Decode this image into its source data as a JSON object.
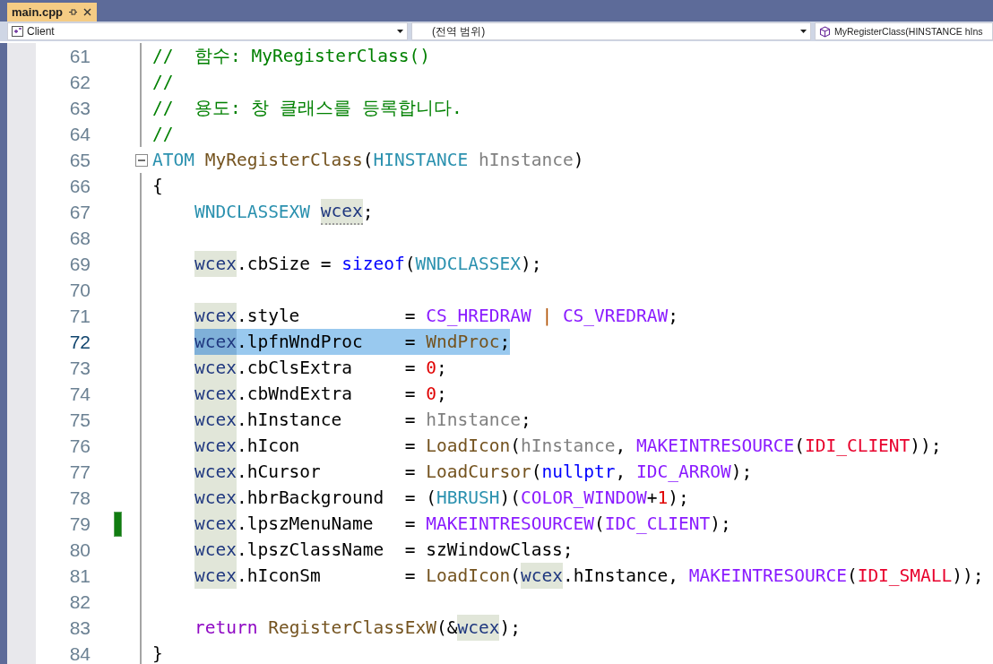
{
  "tabs": [
    {
      "label": "main.cpp",
      "selected": true
    }
  ],
  "navigation": {
    "project": "Client",
    "scope": "(전역 범위)",
    "member": "MyRegisterClass(HINSTANCE hIns"
  },
  "lines": [
    {
      "number": "61",
      "selected": false,
      "changed": false,
      "indented": false,
      "tokens": [
        {
          "kind": "comment",
          "text": "//  함수: MyRegisterClass()"
        }
      ]
    },
    {
      "number": "62",
      "selected": false,
      "changed": false,
      "indented": false,
      "tokens": [
        {
          "kind": "comment",
          "text": "//"
        }
      ]
    },
    {
      "number": "63",
      "selected": false,
      "changed": false,
      "indented": false,
      "tokens": [
        {
          "kind": "comment",
          "text": "//  용도: 창 클래스를 등록합니다."
        }
      ]
    },
    {
      "number": "64",
      "selected": false,
      "changed": false,
      "indented": false,
      "tokens": [
        {
          "kind": "comment",
          "text": "//"
        }
      ]
    },
    {
      "number": "65",
      "selected": false,
      "changed": false,
      "indented": false,
      "expanded": true,
      "tokens": [
        {
          "kind": "type",
          "text": "ATOM"
        },
        {
          "kind": "function",
          "text": " MyRegisterClass"
        },
        {
          "kind": "plain",
          "text": "("
        },
        {
          "kind": "type",
          "text": "HINSTANCE"
        },
        {
          "kind": "param",
          "text": " hInstance"
        },
        {
          "kind": "plain",
          "text": ")"
        }
      ]
    },
    {
      "number": "66",
      "selected": false,
      "changed": false,
      "indented": false,
      "tokens": [
        {
          "kind": "plain",
          "text": "{"
        }
      ]
    },
    {
      "number": "67",
      "selected": false,
      "changed": false,
      "indented": true,
      "tokens": [
        {
          "kind": "type",
          "text": "WNDCLASSEXW "
        },
        {
          "kind": "local",
          "text": "wcex",
          "hint": true
        },
        {
          "kind": "plain",
          "text": ";"
        }
      ]
    },
    {
      "number": "68",
      "selected": false,
      "changed": false
    },
    {
      "number": "69",
      "selected": false,
      "changed": false,
      "indented": true,
      "tokens": [
        {
          "kind": "local",
          "text": "wcex"
        },
        {
          "kind": "plain",
          "text": ".cbSize = "
        },
        {
          "kind": "keyword",
          "text": "sizeof"
        },
        {
          "kind": "plain",
          "text": "("
        },
        {
          "kind": "type",
          "text": "WNDCLASSEX"
        },
        {
          "kind": "plain",
          "text": ");"
        }
      ]
    },
    {
      "number": "70",
      "selected": false,
      "changed": false
    },
    {
      "number": "71",
      "selected": false,
      "changed": false,
      "indented": true,
      "tokens": [
        {
          "kind": "local",
          "text": "wcex"
        },
        {
          "kind": "plain",
          "text": ".style          = "
        },
        {
          "kind": "macro",
          "text": "CS_HREDRAW"
        },
        {
          "kind": "operator",
          "text": " |"
        },
        {
          "kind": "macro",
          "text": " CS_VREDRAW"
        },
        {
          "kind": "plain",
          "text": ";"
        }
      ]
    },
    {
      "number": "72",
      "selected": true,
      "changed": false,
      "indented": true,
      "tokens": [
        {
          "kind": "local",
          "text": "wcex"
        },
        {
          "kind": "plain",
          "text": ".lpfnWndProc    = "
        },
        {
          "kind": "function",
          "text": "WndProc"
        },
        {
          "kind": "plain",
          "text": ";"
        }
      ]
    },
    {
      "number": "73",
      "selected": false,
      "changed": false,
      "indented": true,
      "tokens": [
        {
          "kind": "local",
          "text": "wcex"
        },
        {
          "kind": "plain",
          "text": ".cbClsExtra     = "
        },
        {
          "kind": "number",
          "text": "0"
        },
        {
          "kind": "plain",
          "text": ";"
        }
      ]
    },
    {
      "number": "74",
      "selected": false,
      "changed": false,
      "indented": true,
      "tokens": [
        {
          "kind": "local",
          "text": "wcex"
        },
        {
          "kind": "plain",
          "text": ".cbWndExtra     = "
        },
        {
          "kind": "number",
          "text": "0"
        },
        {
          "kind": "plain",
          "text": ";"
        }
      ]
    },
    {
      "number": "75",
      "selected": false,
      "changed": false,
      "indented": true,
      "tokens": [
        {
          "kind": "local",
          "text": "wcex"
        },
        {
          "kind": "plain",
          "text": ".hInstance      = "
        },
        {
          "kind": "param",
          "text": "hInstance"
        },
        {
          "kind": "plain",
          "text": ";"
        }
      ]
    },
    {
      "number": "76",
      "selected": false,
      "changed": false,
      "indented": true,
      "tokens": [
        {
          "kind": "local",
          "text": "wcex"
        },
        {
          "kind": "plain",
          "text": ".hIcon          = "
        },
        {
          "kind": "function",
          "text": "LoadIcon"
        },
        {
          "kind": "plain",
          "text": "("
        },
        {
          "kind": "param",
          "text": "hInstance"
        },
        {
          "kind": "plain",
          "text": ", "
        },
        {
          "kind": "macro",
          "text": "MAKEINTRESOURCE"
        },
        {
          "kind": "plain",
          "text": "("
        },
        {
          "kind": "resource",
          "text": "IDI_CLIENT"
        },
        {
          "kind": "plain",
          "text": "));"
        }
      ]
    },
    {
      "number": "77",
      "selected": false,
      "changed": false,
      "indented": true,
      "tokens": [
        {
          "kind": "local",
          "text": "wcex"
        },
        {
          "kind": "plain",
          "text": ".hCursor        = "
        },
        {
          "kind": "function",
          "text": "LoadCursor"
        },
        {
          "kind": "plain",
          "text": "("
        },
        {
          "kind": "keyword",
          "text": "nullptr"
        },
        {
          "kind": "plain",
          "text": ", "
        },
        {
          "kind": "macro",
          "text": "IDC_ARROW"
        },
        {
          "kind": "plain",
          "text": ");"
        }
      ]
    },
    {
      "number": "78",
      "selected": false,
      "changed": false,
      "indented": true,
      "tokens": [
        {
          "kind": "local",
          "text": "wcex"
        },
        {
          "kind": "plain",
          "text": ".hbrBackground  = ("
        },
        {
          "kind": "type",
          "text": "HBRUSH"
        },
        {
          "kind": "plain",
          "text": ")("
        },
        {
          "kind": "macro",
          "text": "COLOR_WINDOW"
        },
        {
          "kind": "plain",
          "text": "+"
        },
        {
          "kind": "number",
          "text": "1"
        },
        {
          "kind": "plain",
          "text": ");"
        }
      ]
    },
    {
      "number": "79",
      "selected": false,
      "changed": true,
      "indented": true,
      "tokens": [
        {
          "kind": "local",
          "text": "wcex"
        },
        {
          "kind": "plain",
          "text": ".lpszMenuName   = "
        },
        {
          "kind": "macro",
          "text": "MAKEINTRESOURCEW"
        },
        {
          "kind": "plain",
          "text": "("
        },
        {
          "kind": "macro",
          "text": "IDC_CLIENT"
        },
        {
          "kind": "plain",
          "text": ");"
        }
      ]
    },
    {
      "number": "80",
      "selected": false,
      "changed": false,
      "indented": true,
      "tokens": [
        {
          "kind": "local",
          "text": "wcex"
        },
        {
          "kind": "plain",
          "text": ".lpszClassName  = szWindowClass;"
        }
      ]
    },
    {
      "number": "81",
      "selected": false,
      "changed": false,
      "indented": true,
      "tokens": [
        {
          "kind": "local",
          "text": "wcex"
        },
        {
          "kind": "plain",
          "text": ".hIconSm        = "
        },
        {
          "kind": "function",
          "text": "LoadIcon"
        },
        {
          "kind": "plain",
          "text": "("
        },
        {
          "kind": "local",
          "text": "wcex"
        },
        {
          "kind": "plain",
          "text": ".hInstance, "
        },
        {
          "kind": "macro",
          "text": "MAKEINTRESOURCE"
        },
        {
          "kind": "plain",
          "text": "("
        },
        {
          "kind": "resource",
          "text": "IDI_SMALL"
        },
        {
          "kind": "plain",
          "text": "));"
        }
      ]
    },
    {
      "number": "82",
      "selected": false,
      "changed": false
    },
    {
      "number": "83",
      "selected": false,
      "changed": false,
      "indented": true,
      "tokens": [
        {
          "kind": "control",
          "text": "return"
        },
        {
          "kind": "function",
          "text": " RegisterClassExW"
        },
        {
          "kind": "plain",
          "text": "(&"
        },
        {
          "kind": "local",
          "text": "wcex"
        },
        {
          "kind": "plain",
          "text": ");"
        }
      ]
    },
    {
      "number": "84",
      "selected": false,
      "changed": false,
      "indented": false,
      "tokens": [
        {
          "kind": "plain",
          "text": "}"
        }
      ]
    }
  ]
}
